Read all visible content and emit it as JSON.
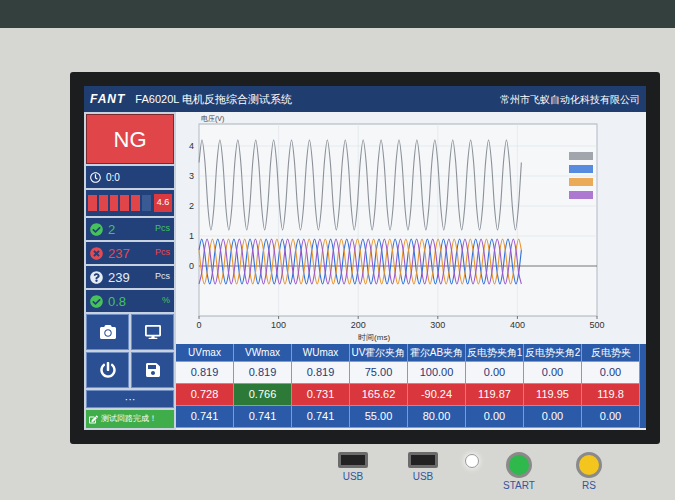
{
  "header": {
    "logo": "FANT",
    "title": "FA6020L 电机反拖综合测试系统",
    "company": "常州市飞蚁自动化科技有限公司"
  },
  "sidebar": {
    "result": "NG",
    "pass": false,
    "timer": "0:0",
    "meter": {
      "level": 0.83,
      "reading": "4.6"
    },
    "stats": [
      {
        "kind": "ok",
        "value": "2",
        "unit": "Pcs",
        "color": "#45c25a"
      },
      {
        "kind": "ng",
        "value": "237",
        "unit": "Pcs",
        "color": "#e8484e"
      },
      {
        "kind": "total",
        "value": "239",
        "unit": "Pcs",
        "color": "#e6ebf3"
      },
      {
        "kind": "rate",
        "value": "0.8",
        "unit": "%",
        "color": "#45c25a"
      }
    ],
    "tools": [
      {
        "kind": "camera"
      },
      {
        "kind": "monitor"
      },
      {
        "kind": "power"
      },
      {
        "kind": "save"
      }
    ],
    "more": "···",
    "status": "测试回路完成！"
  },
  "chart": {
    "y_label": "电压(V)",
    "x_label": "时间(ms)",
    "y_ticks": [
      "0",
      "1",
      "2",
      "3",
      "4"
    ],
    "x_ticks": [
      "0",
      "100",
      "200",
      "300",
      "400",
      "500"
    ],
    "x_max_ms": 405,
    "series": [
      {
        "color": "#8c9199",
        "values": [
          3.45,
          4.2,
          3.45,
          1.95,
          1.2,
          1.95,
          3.45,
          4.2,
          3.45,
          1.95,
          1.2,
          1.95,
          3.45,
          4.2,
          3.45,
          1.95,
          1.2,
          1.95,
          3.45,
          4.2,
          3.45,
          1.95,
          1.2,
          1.95,
          3.45,
          4.2,
          3.45,
          1.95,
          1.2,
          1.95,
          3.45,
          4.2,
          3.45,
          1.95,
          1.2,
          1.95,
          3.45,
          4.2,
          3.45,
          1.95,
          1.2,
          1.95,
          3.45,
          4.2,
          3.45,
          1.95,
          1.2,
          1.95,
          3.45,
          4.2,
          3.45,
          1.95,
          1.2,
          1.95,
          3.45,
          4.2,
          3.45,
          1.95,
          1.2,
          1.95,
          3.45,
          4.2,
          3.45,
          1.95,
          1.2,
          1.95,
          3.45,
          4.2,
          3.45,
          1.95,
          1.2,
          1.95,
          3.45,
          4.2,
          3.45,
          1.95,
          1.2,
          1.95,
          3.45,
          4.2,
          3.45,
          1.95,
          1.2,
          1.95,
          3.45,
          4.2,
          3.45,
          1.95,
          1.2,
          1.95,
          3.45,
          4.2,
          3.45,
          1.95,
          1.2,
          1.95,
          3.45,
          4.2,
          3.45,
          1.95,
          1.2,
          1.95,
          3.45,
          4.2,
          3.45,
          1.95,
          1.2,
          1.95,
          3.45
        ]
      },
      {
        "color": "#2f6fd8",
        "values": [
          0.53,
          0.9,
          0.53,
          -0.23,
          -0.6,
          -0.23,
          0.53,
          0.9,
          0.53,
          -0.23,
          -0.6,
          -0.23,
          0.53,
          0.9,
          0.53,
          -0.23,
          -0.6,
          -0.23,
          0.53,
          0.9,
          0.53,
          -0.23,
          -0.6,
          -0.23,
          0.53,
          0.9,
          0.53,
          -0.23,
          -0.6,
          -0.23,
          0.53,
          0.9,
          0.53,
          -0.23,
          -0.6,
          -0.23,
          0.53,
          0.9,
          0.53,
          -0.23,
          -0.6,
          -0.23,
          0.53,
          0.9,
          0.53,
          -0.23,
          -0.6,
          -0.23,
          0.53,
          0.9,
          0.53,
          -0.23,
          -0.6,
          -0.23,
          0.53,
          0.9,
          0.53,
          -0.23,
          -0.6,
          -0.23,
          0.53,
          0.9,
          0.53,
          -0.23,
          -0.6,
          -0.23,
          0.53,
          0.9,
          0.53,
          -0.23,
          -0.6,
          -0.23,
          0.53,
          0.9,
          0.53,
          -0.23,
          -0.6,
          -0.23,
          0.53,
          0.9,
          0.53,
          -0.23,
          -0.6,
          -0.23,
          0.53,
          0.9,
          0.53,
          -0.23,
          -0.6,
          -0.23,
          0.53,
          0.9,
          0.53,
          -0.23,
          -0.6,
          -0.23,
          0.53,
          0.9,
          0.53,
          -0.23,
          -0.6,
          -0.23,
          0.53,
          0.9,
          0.53,
          -0.23,
          -0.6,
          -0.23,
          0.53,
          0.9,
          0.53,
          -0.23,
          -0.6,
          -0.23,
          0.53,
          0.9,
          0.53,
          -0.23,
          -0.6,
          -0.23,
          0.53
        ]
      },
      {
        "color": "#e8962e",
        "values": [
          0.53,
          -0.23,
          -0.6,
          -0.23,
          0.53,
          0.9,
          0.53,
          -0.23,
          -0.6,
          -0.23,
          0.53,
          0.9,
          0.53,
          -0.23,
          -0.6,
          -0.23,
          0.53,
          0.9,
          0.53,
          -0.23,
          -0.6,
          -0.23,
          0.53,
          0.9,
          0.53,
          -0.23,
          -0.6,
          -0.23,
          0.53,
          0.9,
          0.53,
          -0.23,
          -0.6,
          -0.23,
          0.53,
          0.9,
          0.53,
          -0.23,
          -0.6,
          -0.23,
          0.53,
          0.9,
          0.53,
          -0.23,
          -0.6,
          -0.23,
          0.53,
          0.9,
          0.53,
          -0.23,
          -0.6,
          -0.23,
          0.53,
          0.9,
          0.53,
          -0.23,
          -0.6,
          -0.23,
          0.53,
          0.9,
          0.53,
          -0.23,
          -0.6,
          -0.23,
          0.53,
          0.9,
          0.53,
          -0.23,
          -0.6,
          -0.23,
          0.53,
          0.9,
          0.53,
          -0.23,
          -0.6,
          -0.23,
          0.53,
          0.9,
          0.53,
          -0.23,
          -0.6,
          -0.23,
          0.53,
          0.9,
          0.53,
          -0.23,
          -0.6,
          -0.23,
          0.53,
          0.9,
          0.53,
          -0.23,
          -0.6,
          -0.23,
          0.53,
          0.9,
          0.53,
          -0.23,
          -0.6,
          -0.23,
          0.53,
          0.9,
          0.53,
          -0.23,
          -0.6,
          -0.23,
          0.53,
          0.9,
          0.53,
          -0.23,
          -0.6,
          -0.23,
          0.53,
          0.9,
          0.53,
          -0.23,
          -0.6,
          -0.23,
          0.53,
          0.9,
          0.53
        ]
      },
      {
        "color": "#9b59c6",
        "values": [
          -0.6,
          -0.23,
          0.53,
          0.9,
          0.53,
          -0.23,
          -0.6,
          -0.23,
          0.53,
          0.9,
          0.53,
          -0.23,
          -0.6,
          -0.23,
          0.53,
          0.9,
          0.53,
          -0.23,
          -0.6,
          -0.23,
          0.53,
          0.9,
          0.53,
          -0.23,
          -0.6,
          -0.23,
          0.53,
          0.9,
          0.53,
          -0.23,
          -0.6,
          -0.23,
          0.53,
          0.9,
          0.53,
          -0.23,
          -0.6,
          -0.23,
          0.53,
          0.9,
          0.53,
          -0.23,
          -0.6,
          -0.23,
          0.53,
          0.9,
          0.53,
          -0.23,
          -0.6,
          -0.23,
          0.53,
          0.9,
          0.53,
          -0.23,
          -0.6,
          -0.23,
          0.53,
          0.9,
          0.53,
          -0.23,
          -0.6,
          -0.23,
          0.53,
          0.9,
          0.53,
          -0.23,
          -0.6,
          -0.23,
          0.53,
          0.9,
          0.53,
          -0.23,
          -0.6,
          -0.23,
          0.53,
          0.9,
          0.53,
          -0.23,
          -0.6,
          -0.23,
          0.53,
          0.9,
          0.53,
          -0.23,
          -0.6,
          -0.23,
          0.53,
          0.9,
          0.53,
          -0.23,
          -0.6,
          -0.23,
          0.53,
          0.9,
          0.53,
          -0.23,
          -0.6,
          -0.23,
          0.53,
          0.9,
          0.53,
          -0.23,
          -0.6,
          -0.23,
          0.53,
          0.9,
          0.53,
          -0.23,
          -0.6,
          -0.23,
          0.53,
          0.9,
          0.53,
          -0.23,
          -0.6,
          -0.23,
          0.53,
          0.9,
          0.53,
          -0.23,
          -0.6
        ]
      }
    ]
  },
  "table": {
    "columns": [
      "UVmax",
      "VWmax",
      "WUmax",
      "UV霍尔夹角",
      "霍尔AB夹角",
      "反电势夹角1",
      "反电势夹角2",
      "反电势夹"
    ],
    "rows": [
      {
        "kind": "max",
        "cells": [
          {
            "text": "0.819",
            "state": "plain"
          },
          {
            "text": "0.819",
            "state": "plain"
          },
          {
            "text": "0.819",
            "state": "plain"
          },
          {
            "text": "75.00",
            "state": "plain"
          },
          {
            "text": "100.00",
            "state": "plain"
          },
          {
            "text": "0.00",
            "state": "plain"
          },
          {
            "text": "0.00",
            "state": "plain"
          },
          {
            "text": "0.00",
            "state": "plain"
          }
        ]
      },
      {
        "kind": "result",
        "cells": [
          {
            "text": "0.728",
            "state": "fail"
          },
          {
            "text": "0.766",
            "state": "pass"
          },
          {
            "text": "0.731",
            "state": "fail"
          },
          {
            "text": "165.62",
            "state": "fail"
          },
          {
            "text": "-90.24",
            "state": "fail"
          },
          {
            "text": "119.87",
            "state": "fail"
          },
          {
            "text": "119.95",
            "state": "fail"
          },
          {
            "text": "119.8",
            "state": "fail"
          }
        ]
      },
      {
        "kind": "min",
        "cells": [
          {
            "text": "0.741",
            "state": "plain"
          },
          {
            "text": "0.741",
            "state": "plain"
          },
          {
            "text": "0.741",
            "state": "plain"
          },
          {
            "text": "55.00",
            "state": "plain"
          },
          {
            "text": "80.00",
            "state": "plain"
          },
          {
            "text": "0.00",
            "state": "plain"
          },
          {
            "text": "0.00",
            "state": "plain"
          },
          {
            "text": "0.00",
            "state": "plain"
          }
        ]
      }
    ]
  },
  "device": {
    "ports": [
      "USB",
      "USB"
    ],
    "led_on": true,
    "buttons": [
      {
        "label": "START",
        "color": "#2fb84c"
      },
      {
        "label": "RS",
        "color": "#f3c51d"
      }
    ]
  }
}
